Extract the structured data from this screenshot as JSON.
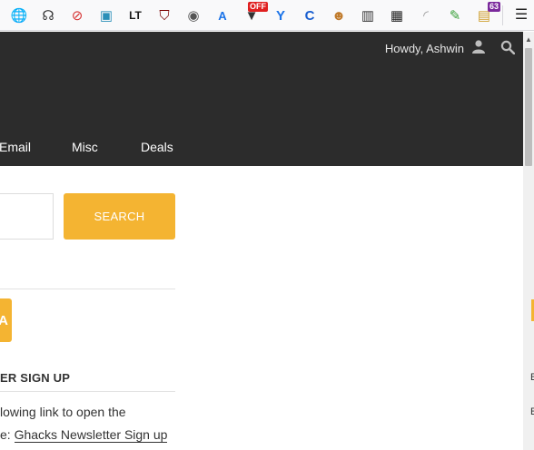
{
  "toolbar": {
    "extensions": [
      {
        "name": "globe-icon",
        "glyph": "🌐",
        "color": "#3d7be0"
      },
      {
        "name": "user-script-icon",
        "glyph": "☊",
        "color": "#333333"
      },
      {
        "name": "blocker-icon",
        "glyph": "⊘",
        "color": "#d63232"
      },
      {
        "name": "floppy-icon",
        "glyph": "▣",
        "color": "#2a8fb8"
      },
      {
        "name": "languagetool-icon",
        "glyph": "LT",
        "color": "#1a1a1a"
      },
      {
        "name": "ublock-icon",
        "glyph": "⛉",
        "color": "#7a0000"
      },
      {
        "name": "ghost-icon",
        "glyph": "◉",
        "color": "#555555"
      },
      {
        "name": "translate-icon",
        "glyph": "A",
        "color": "#1a73e8"
      },
      {
        "name": "v-off-icon",
        "glyph": "▼",
        "color": "#333333",
        "badge": "OFF",
        "badge_color": "#e02020"
      },
      {
        "name": "shield-blue-icon",
        "glyph": "Y",
        "color": "#1a73e8"
      },
      {
        "name": "c-icon",
        "glyph": "C",
        "color": "#1a5fd0"
      },
      {
        "name": "face-icon",
        "glyph": "☻",
        "color": "#c07a2a"
      },
      {
        "name": "fence-icon",
        "glyph": "▥",
        "color": "#333333"
      },
      {
        "name": "apps-grid-icon",
        "glyph": "▦",
        "color": "#222222"
      },
      {
        "name": "rss-icon",
        "glyph": "◜",
        "color": "#999999"
      },
      {
        "name": "pencil-icon",
        "glyph": "✎",
        "color": "#3aa03a"
      },
      {
        "name": "folder-badge-icon",
        "glyph": "▤",
        "color": "#d0a030",
        "badge": "63",
        "badge_color": "#7b2a9c"
      }
    ],
    "menu_icon": "☰"
  },
  "header": {
    "greeting": "Howdy, Ashwin",
    "nav": [
      "Email",
      "Misc",
      "Deals"
    ]
  },
  "search": {
    "button_label": "SEARCH",
    "placeholder": ""
  },
  "promo": {
    "tile_text": "A"
  },
  "newsletter": {
    "heading": "ER SIGN UP",
    "line1": "lowing link to open the",
    "line2_prefix": "e: ",
    "link_text": "Ghacks Newsletter Sign up"
  },
  "colors": {
    "accent": "#f4b432",
    "header_bg": "#2c2c2c"
  }
}
